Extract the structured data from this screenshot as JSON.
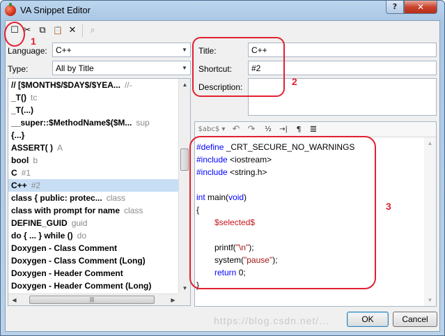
{
  "window": {
    "title": "VA Snippet Editor",
    "help": "?",
    "close": "✕"
  },
  "toolbar": {
    "new": "☐",
    "cut": "✂",
    "copy": "⧉",
    "paste": "📋",
    "delete": "✕",
    "find": "⌕"
  },
  "filters": {
    "language_label": "Language:",
    "language_value": "C++",
    "type_label": "Type:",
    "type_value": "All by Title"
  },
  "snippets": [
    {
      "name": "//   [$MONTH$/$DAY$/$YEA...",
      "shortcut": "//-"
    },
    {
      "name": "_T()",
      "shortcut": "tc"
    },
    {
      "name": "_T(...)",
      "shortcut": ""
    },
    {
      "name": "__super::$MethodName$($M...",
      "shortcut": "sup"
    },
    {
      "name": "{...}",
      "shortcut": ""
    },
    {
      "name": "ASSERT( )",
      "shortcut": "A"
    },
    {
      "name": "bool",
      "shortcut": "b"
    },
    {
      "name": "C",
      "shortcut": "#1"
    },
    {
      "name": "C++",
      "shortcut": "#2",
      "selected": true
    },
    {
      "name": "class   { public: protec...",
      "shortcut": "class"
    },
    {
      "name": "class with prompt for name",
      "shortcut": "class"
    },
    {
      "name": "DEFINE_GUID",
      "shortcut": "guid"
    },
    {
      "name": "do { ... } while ()",
      "shortcut": "do"
    },
    {
      "name": "Doxygen - Class Comment",
      "shortcut": ""
    },
    {
      "name": "Doxygen - Class Comment (Long)",
      "shortcut": ""
    },
    {
      "name": "Doxygen - Header Comment",
      "shortcut": ""
    },
    {
      "name": "Doxygen - Header Comment (Long)",
      "shortcut": ""
    }
  ],
  "details": {
    "title_label": "Title:",
    "title_value": "C++",
    "shortcut_label": "Shortcut:",
    "shortcut_value": "#2",
    "description_label": "Description:",
    "description_value": ""
  },
  "editor_toolbar": {
    "spell": "$abc$ ▾",
    "undo": "↶",
    "redo": "↷",
    "numbered": "½",
    "indent": "→|",
    "pilcrow": "¶",
    "lines": "≣"
  },
  "code": {
    "l1_kw": "#define",
    "l1_rest": " _CRT_SECURE_NO_WARNINGS",
    "l2_kw": "#include",
    "l2_rest": " <iostream>",
    "l3_kw": "#include",
    "l3_rest": " <string.h>",
    "l4_kw": "int",
    "l4_rest": " main(",
    "l4_kw2": "void",
    "l4_end": ")",
    "l5": "{",
    "l6": "$selected$",
    "l7_a": "printf(",
    "l7_str": "\"\\n\"",
    "l7_b": ");",
    "l8_a": "system(",
    "l8_str": "\"pause\"",
    "l8_b": ");",
    "l9_kw": "return",
    "l9_rest": " 0;",
    "l10": "}"
  },
  "buttons": {
    "ok": "OK",
    "cancel": "Cancel"
  },
  "annotations": {
    "a1": "1",
    "a2": "2",
    "a3": "3"
  },
  "watermark": "https://blog.csdn.net/..."
}
